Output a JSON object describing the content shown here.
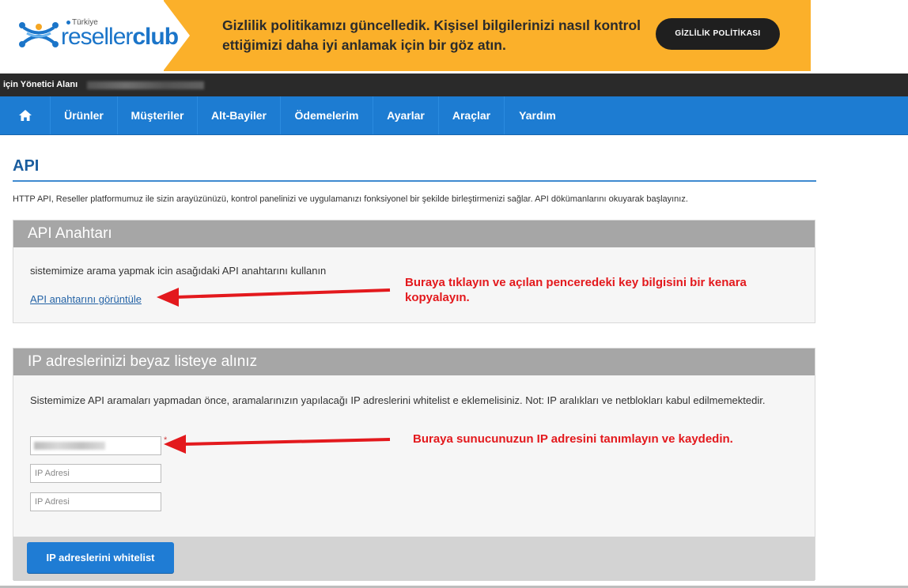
{
  "banner": {
    "logo_sub": "Türkiye",
    "logo_brand_light": "reseller",
    "logo_brand_bold": "club",
    "message": "Gizlilik politikamızı güncelledik. Kişisel bilgilerinizi nasıl kontrol ettiğimizi daha iyi anlamak için bir göz atın.",
    "button_label": "GİZLİLİK POLİTİKASI",
    "background_color": "#fbb02a"
  },
  "admin_bar": {
    "label": "için Yönetici Alanı"
  },
  "nav": {
    "home_icon": "home-icon",
    "items": [
      "Ürünler",
      "Müşteriler",
      "Alt-Bayiler",
      "Ödemelerim",
      "Ayarlar",
      "Araçlar",
      "Yardım"
    ],
    "color": "#1d7cd2"
  },
  "page": {
    "title": "API",
    "intro": "HTTP API, Reseller platformumuz ile sizin arayüzünüzü, kontrol panelinizi ve uygulamanızı fonksiyonel bir şekilde birleştirmenizi sağlar. API dökümanlarını okuyarak başlayınız."
  },
  "api_key_panel": {
    "heading": "API Anahtarı",
    "text": "sistemimize arama yapmak icin asağıdaki API anahtarını kullanın",
    "link": "API anahtarını görüntüle"
  },
  "whitelist_panel": {
    "heading": "IP adreslerinizi beyaz listeye alınız",
    "text": "Sistemimize API aramaları yapmadan önce, aramalarınızın yapılacağı IP adreslerini whitelist e eklemelisiniz. Not: IP aralıkları ve netblokları kabul edilmemektedir.",
    "required_mark": "*",
    "ip_placeholder": "IP Adresi",
    "submit_label": "IP adreslerini whitelist"
  },
  "annotations": {
    "first": "Buraya tıklayın ve açılan penceredeki key bilgisini bir kenara kopyalayın.",
    "second": "Buraya sunucunuzun IP adresini tanımlayın ve kaydedin.",
    "color": "#e3191d"
  }
}
